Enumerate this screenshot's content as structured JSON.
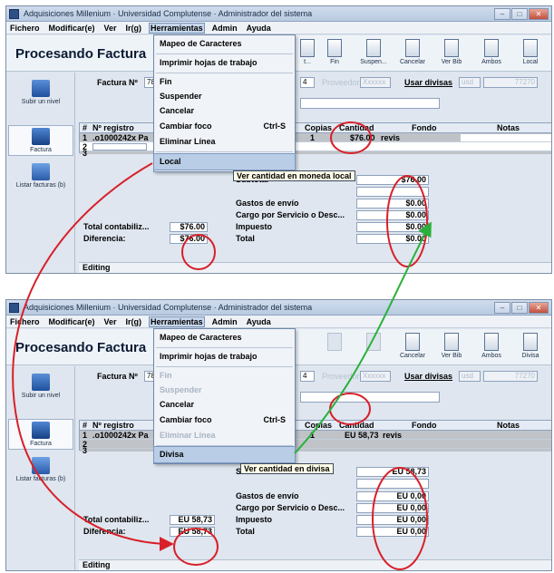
{
  "window_title": "Adquisiciones Millenium · Universidad Complutense · Administrador del sistema",
  "menubar": [
    "Fichero",
    "Modificar(e)",
    "Ver",
    "Ir(g)",
    "Herramientas",
    "Admin",
    "Ayuda"
  ],
  "page_title": "Procesando Factura",
  "top": {
    "toolbar": [
      {
        "label": "t...",
        "icon": "tool-icon"
      },
      {
        "label": "Fin",
        "icon": "stoplight-icon"
      },
      {
        "label": "Suspen...",
        "icon": "stoplight-icon"
      },
      {
        "label": "Cancelar",
        "icon": "stoplight-icon"
      },
      {
        "label": "Ver Bib",
        "icon": "book-icon"
      },
      {
        "label": "Ambos",
        "icon": "document-icon"
      },
      {
        "label": "Local",
        "icon": "pen-icon"
      }
    ],
    "menu": {
      "items": [
        "Mapeo de Caracteres",
        "Imprimir hojas de trabajo",
        "Fin",
        "Suspender",
        "Cancelar",
        "Cambiar foco",
        "Eliminar Línea",
        "Local"
      ],
      "shortcut": "Ctrl-S",
      "highlighted": "Local"
    },
    "tooltip": "Ver cantidad en moneda local",
    "factura_no": "780",
    "factura_mid": "4",
    "proveedor": "Proveedor",
    "proveedor_value": "Xxxxxx",
    "usar_divisas": "Usar divisas",
    "divisa_value": "usd",
    "divisa_rate": "77270",
    "grid_row1": {
      "num": "1",
      "registro": ".o1000242x Pa",
      "copias": "1",
      "cantidad": "$76.00",
      "fondo": "revis"
    },
    "totals": {
      "subtotal": "$76.00",
      "gastos": "$0.00",
      "cargo": "$0.00",
      "impuesto": "$0.00",
      "total": "$0.00",
      "total_contabiliz": "$76.00",
      "diferencia": "$76.00"
    }
  },
  "bottom": {
    "toolbar": [
      {
        "label": "",
        "icon": "square-icon"
      },
      {
        "label": "",
        "icon": "square-icon"
      },
      {
        "label": "Cancelar",
        "icon": "stoplight-icon"
      },
      {
        "label": "Ver Bib",
        "icon": "book-icon"
      },
      {
        "label": "Ambos",
        "icon": "document-icon"
      },
      {
        "label": "Divisa",
        "icon": "pen-icon"
      }
    ],
    "menu": {
      "items": [
        "Mapeo de Caracteres",
        "Imprimir hojas de trabajo",
        "Fin",
        "Suspender",
        "Cancelar",
        "Cambiar foco",
        "Eliminar Línea",
        "Divisa"
      ],
      "shortcut": "Ctrl-S",
      "highlighted": "Divisa"
    },
    "tooltip": "Ver cantidad en divisa",
    "factura_no": "780",
    "factura_mid": "4",
    "proveedor": "Proveedor",
    "proveedor_value": "Xxxxxx",
    "usar_divisas": "Usar divisas",
    "divisa_value": "usd",
    "divisa_rate": "77270",
    "grid_row1": {
      "num": "1",
      "registro": ".o1000242x Pa",
      "copias": "1",
      "cantidad": "EU 58,73",
      "fondo": "revis"
    },
    "totals": {
      "subtotal": "EU 58,73",
      "gastos": "EU 0,00",
      "cargo": "EU 0,00",
      "impuesto": "EU 0,00",
      "total": "EU 0,00",
      "total_contabiliz": "EU 58,73",
      "diferencia": "EU 58,73"
    }
  },
  "sidebar": [
    "Subir un nivel",
    "Factura",
    "Listar facturas (b)"
  ],
  "grid_headers": {
    "num": "#",
    "registro": "Nº registro",
    "copias": "Copias",
    "cantidad": "Cantidad",
    "fondo": "Fondo",
    "notas": "Notas"
  },
  "row_numbers": [
    "2",
    "3"
  ],
  "total_labels": {
    "subtotal": "Subtotal",
    "gastos": "Gastos de envío",
    "cargo": "Cargo por Servicio o Desc...",
    "impuesto": "Impuesto",
    "total": "Total",
    "total_contabiliz": "Total contabiliz...",
    "diferencia": "Diferencia:"
  },
  "factura_label": "Factura Nº",
  "status": "Editing",
  "colors": {
    "annotation_red": "#d8202a",
    "annotation_green": "#2ab03a",
    "menu_highlight": "#b9cde6",
    "grid_gray": "#bfc3c8"
  }
}
